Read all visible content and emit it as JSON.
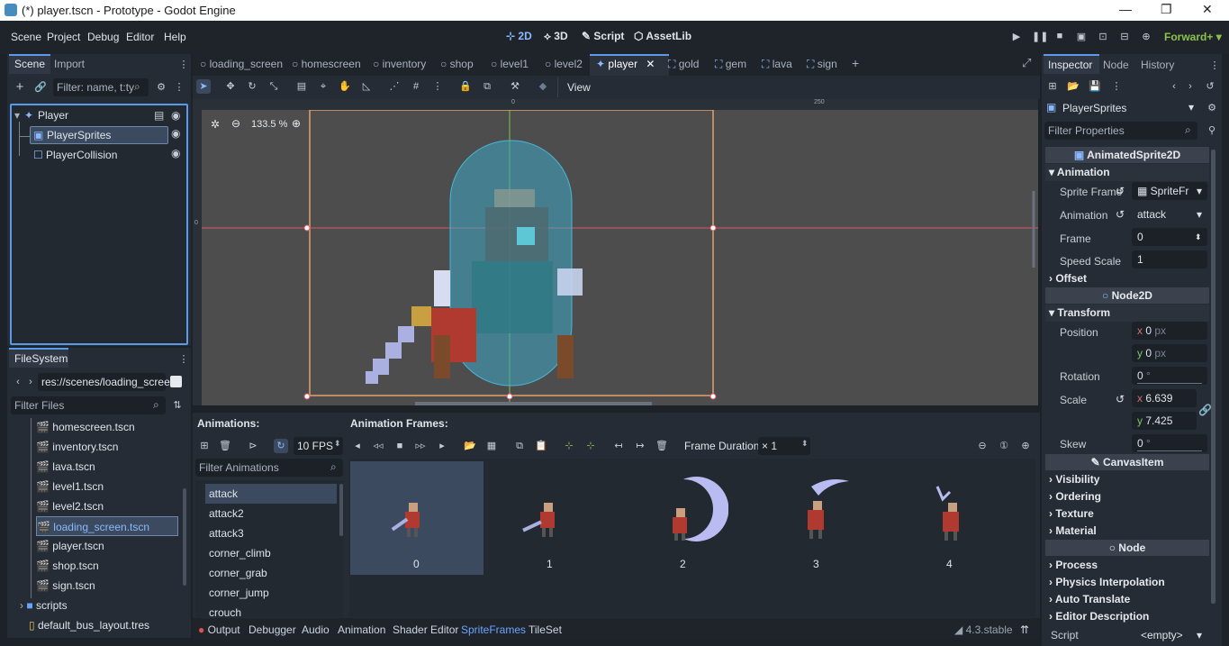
{
  "window": {
    "title": "(*) player.tscn - Prototype - Godot Engine"
  },
  "menu": [
    "Scene",
    "Project",
    "Debug",
    "Editor",
    "Help"
  ],
  "workspaces": [
    "2D",
    "3D",
    "Script",
    "AssetLib"
  ],
  "renderer": "Forward+",
  "scene_dock": {
    "tabs": [
      "Scene",
      "Import"
    ],
    "filter_placeholder": "Filter: name, t:ty",
    "nodes": [
      "Player",
      "PlayerSprites",
      "PlayerCollision"
    ]
  },
  "filesystem": {
    "tab": "FileSystem",
    "path": "res://scenes/loading_screen.",
    "filter_placeholder": "Filter Files",
    "files": [
      "homescreen.tscn",
      "inventory.tscn",
      "lava.tscn",
      "level1.tscn",
      "level2.tscn",
      "loading_screen.tscn",
      "player.tscn",
      "shop.tscn",
      "sign.tscn",
      "scripts",
      "default_bus_layout.tres"
    ]
  },
  "editor_tabs": [
    "loading_screen",
    "homescreen",
    "inventory",
    "shop",
    "level1",
    "level2",
    "player",
    "gold",
    "gem",
    "lava",
    "sign"
  ],
  "toolbar": {
    "view": "View"
  },
  "viewport": {
    "zoom": "133.5 %",
    "ruler_labels": [
      "0",
      "250",
      "0"
    ]
  },
  "spriteframes": {
    "animations_label": "Animations:",
    "frames_label": "Animation Frames:",
    "fps": "10 FPS",
    "frame_duration_label": "Frame Duration:",
    "frame_duration_value": "× 1",
    "filter_placeholder": "Filter Animations",
    "animations": [
      "attack",
      "attack2",
      "attack3",
      "corner_climb",
      "corner_grab",
      "corner_jump",
      "crouch"
    ],
    "frames": [
      "0",
      "1",
      "2",
      "3",
      "4"
    ]
  },
  "bottom_tabs": [
    "Output",
    "Debugger",
    "Audio",
    "Animation",
    "Shader Editor",
    "SpriteFrames",
    "TileSet"
  ],
  "version": "4.3.stable",
  "inspector": {
    "tabs": [
      "Inspector",
      "Node",
      "History"
    ],
    "node": "PlayerSprites",
    "filter_placeholder": "Filter Properties",
    "class": "AnimatedSprite2D",
    "animation_section": "Animation",
    "sprite_frames_label": "Sprite Frame",
    "sprite_frames_value": "SpriteFr",
    "animation_label": "Animation",
    "animation_value": "attack",
    "frame_label": "Frame",
    "frame_value": "0",
    "speed_label": "Speed Scale",
    "speed_value": "1",
    "offset": "Offset",
    "node2d": "Node2D",
    "transform": "Transform",
    "position_label": "Position",
    "pos_x": "0",
    "pos_y": "0",
    "px": "px",
    "rotation_label": "Rotation",
    "rotation_value": "0",
    "deg": "°",
    "scale_label": "Scale",
    "scale_x": "6.639",
    "scale_y": "7.425",
    "skew_label": "Skew",
    "skew_value": "0",
    "canvasitem": "CanvasItem",
    "sections": [
      "Visibility",
      "Ordering",
      "Texture",
      "Material"
    ],
    "node_cat": "Node",
    "node_sections": [
      "Process",
      "Physics Interpolation",
      "Auto Translate",
      "Editor Description"
    ],
    "script_label": "Script",
    "script_value": "<empty>"
  }
}
